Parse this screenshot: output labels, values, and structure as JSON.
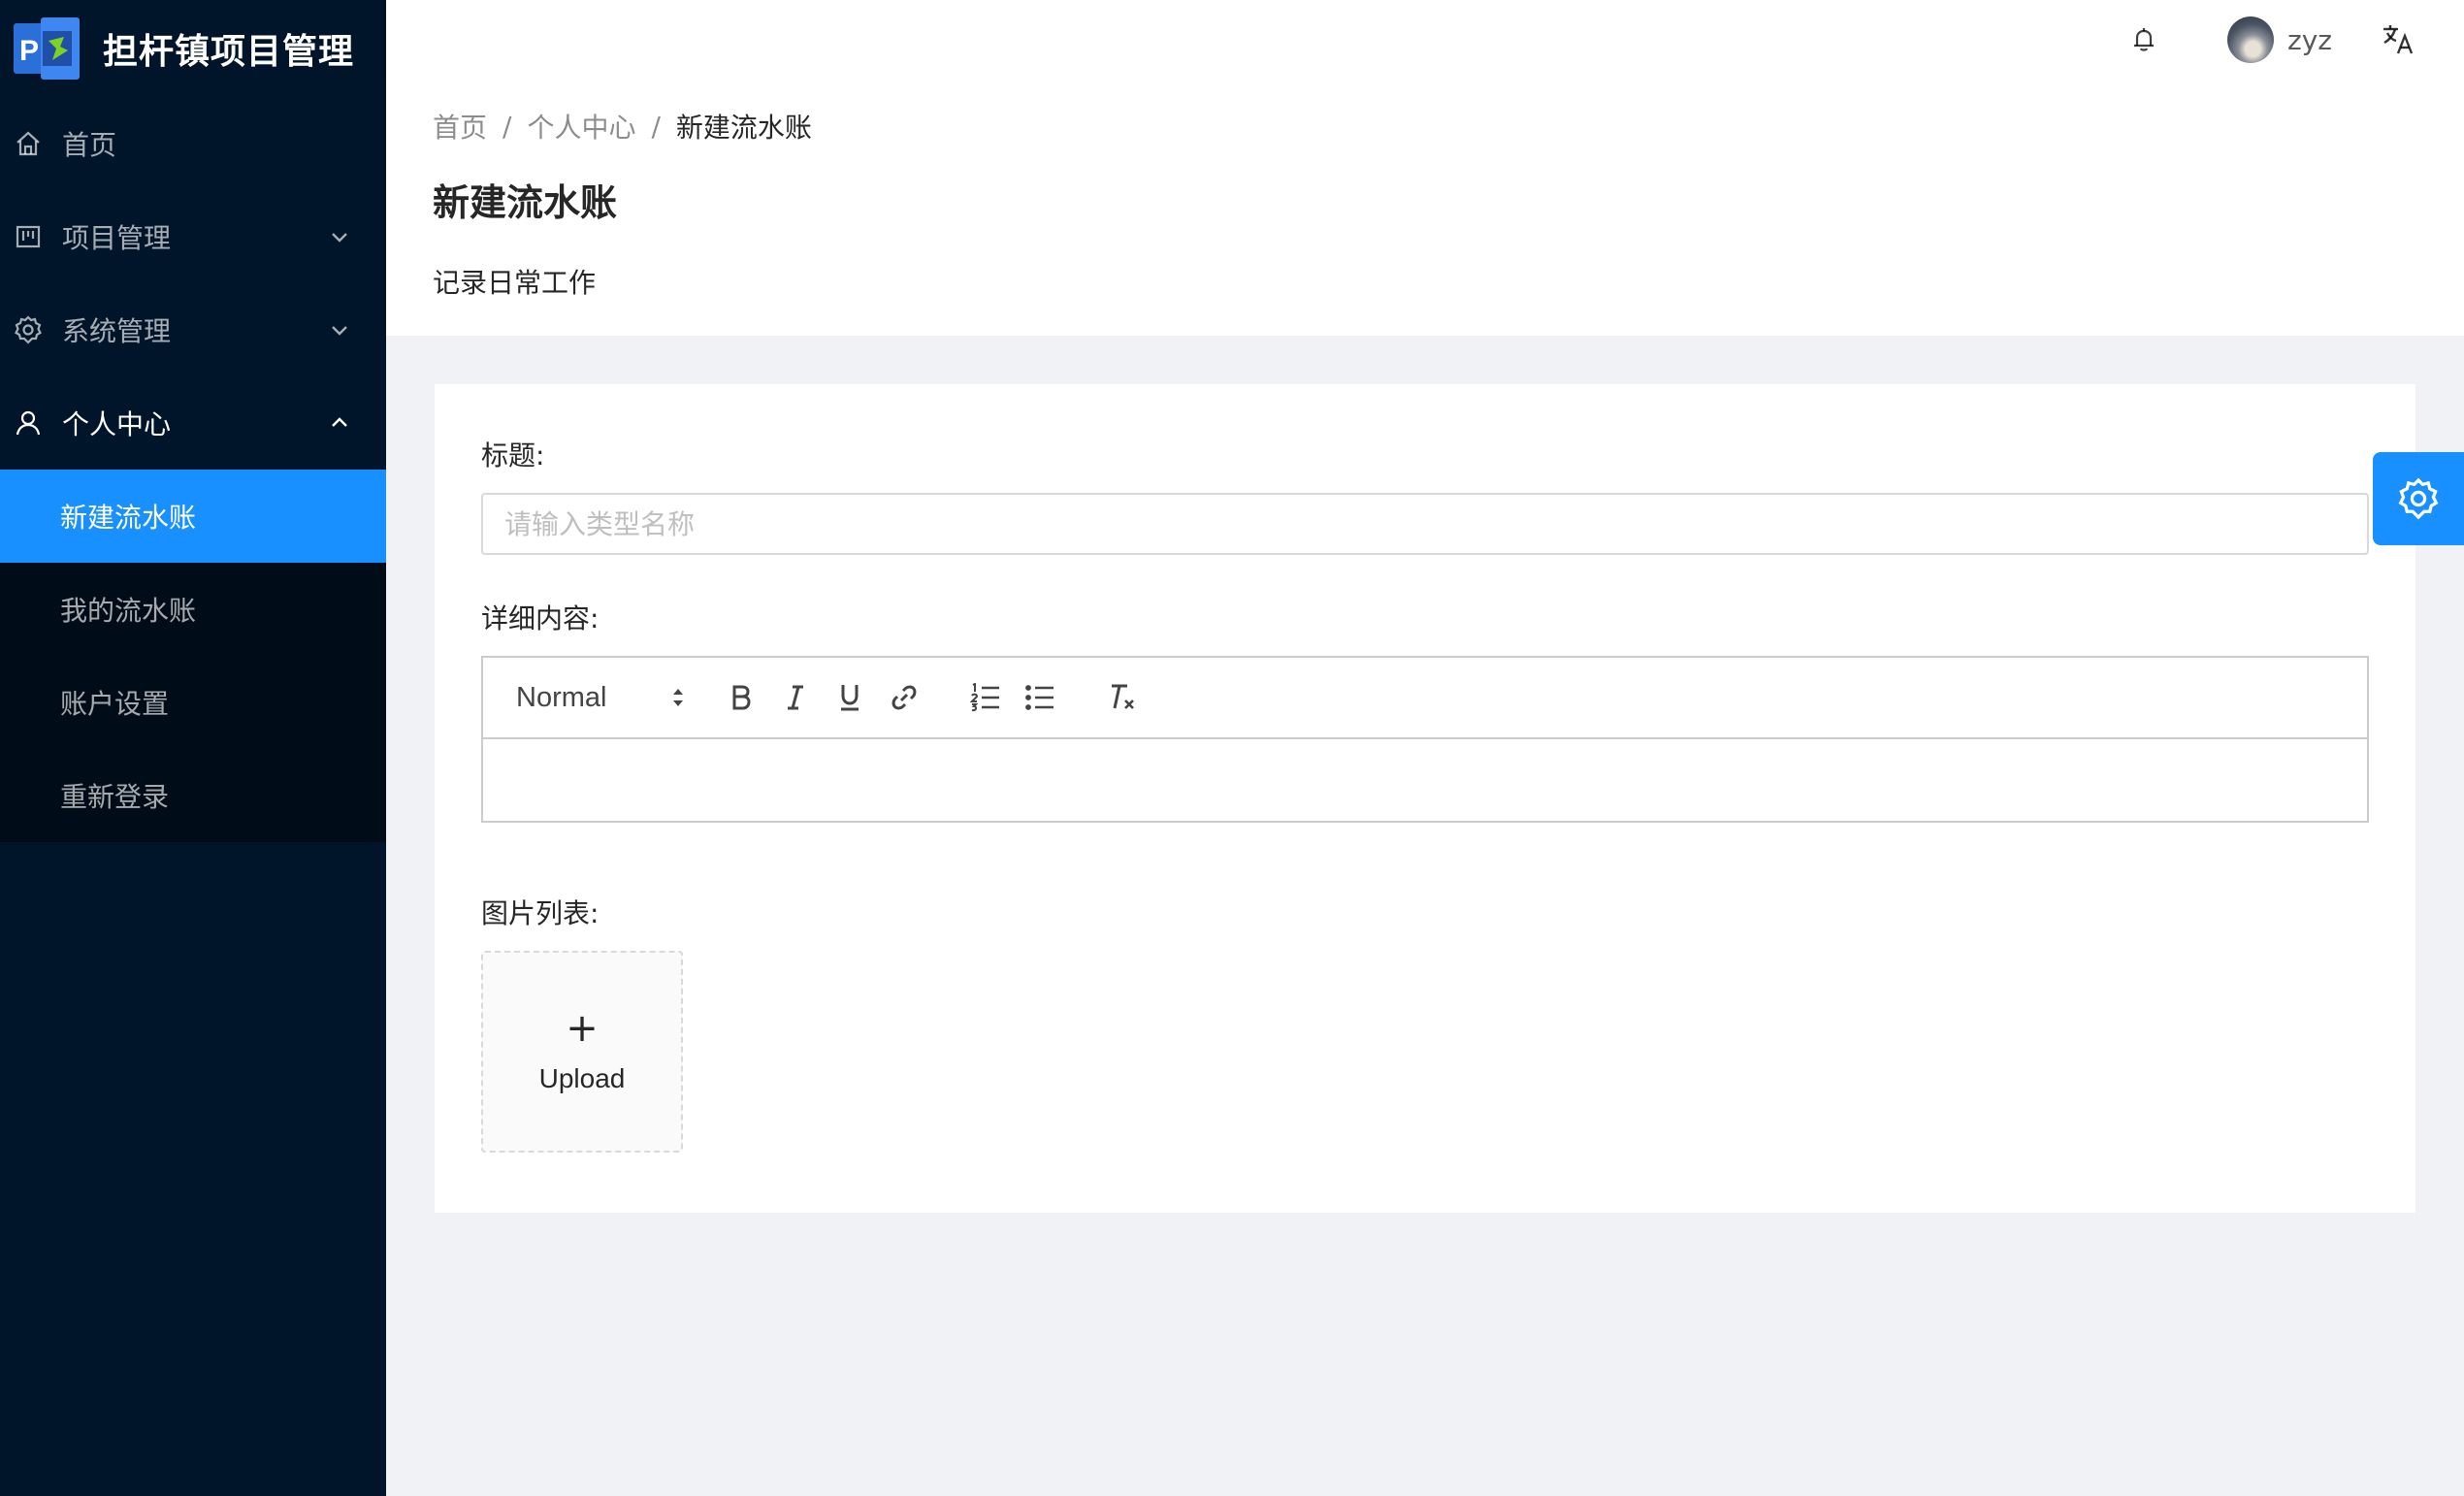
{
  "app": {
    "title": "担杆镇项目管理",
    "logo_letter": "P"
  },
  "sidebar": {
    "items": [
      {
        "label": "首页",
        "icon": "home-icon"
      },
      {
        "label": "项目管理",
        "icon": "project-icon"
      },
      {
        "label": "系统管理",
        "icon": "setting-icon"
      },
      {
        "label": "个人中心",
        "icon": "user-icon"
      }
    ],
    "submenu": [
      {
        "label": "新建流水账",
        "selected": true
      },
      {
        "label": "我的流水账"
      },
      {
        "label": "账户设置"
      },
      {
        "label": "重新登录"
      }
    ]
  },
  "header": {
    "username": "zyz",
    "icons": [
      "bell-icon",
      "avatar",
      "translate-icon"
    ]
  },
  "breadcrumb": {
    "items": [
      "首页",
      "个人中心",
      "新建流水账"
    ],
    "separator": "/"
  },
  "page": {
    "title": "新建流水账",
    "description": "记录日常工作"
  },
  "form": {
    "title_label": "标题:",
    "title_value": "",
    "title_placeholder": "请输入类型名称",
    "content_label": "详细内容:",
    "editor_header_value": "Normal",
    "images_label": "图片列表:",
    "upload_plus": "+",
    "upload_text": "Upload"
  },
  "colors": {
    "sidebar_bg": "#001529",
    "submenu_bg": "#000c17",
    "primary": "#1890ff",
    "content_bg": "#f0f2f5"
  }
}
